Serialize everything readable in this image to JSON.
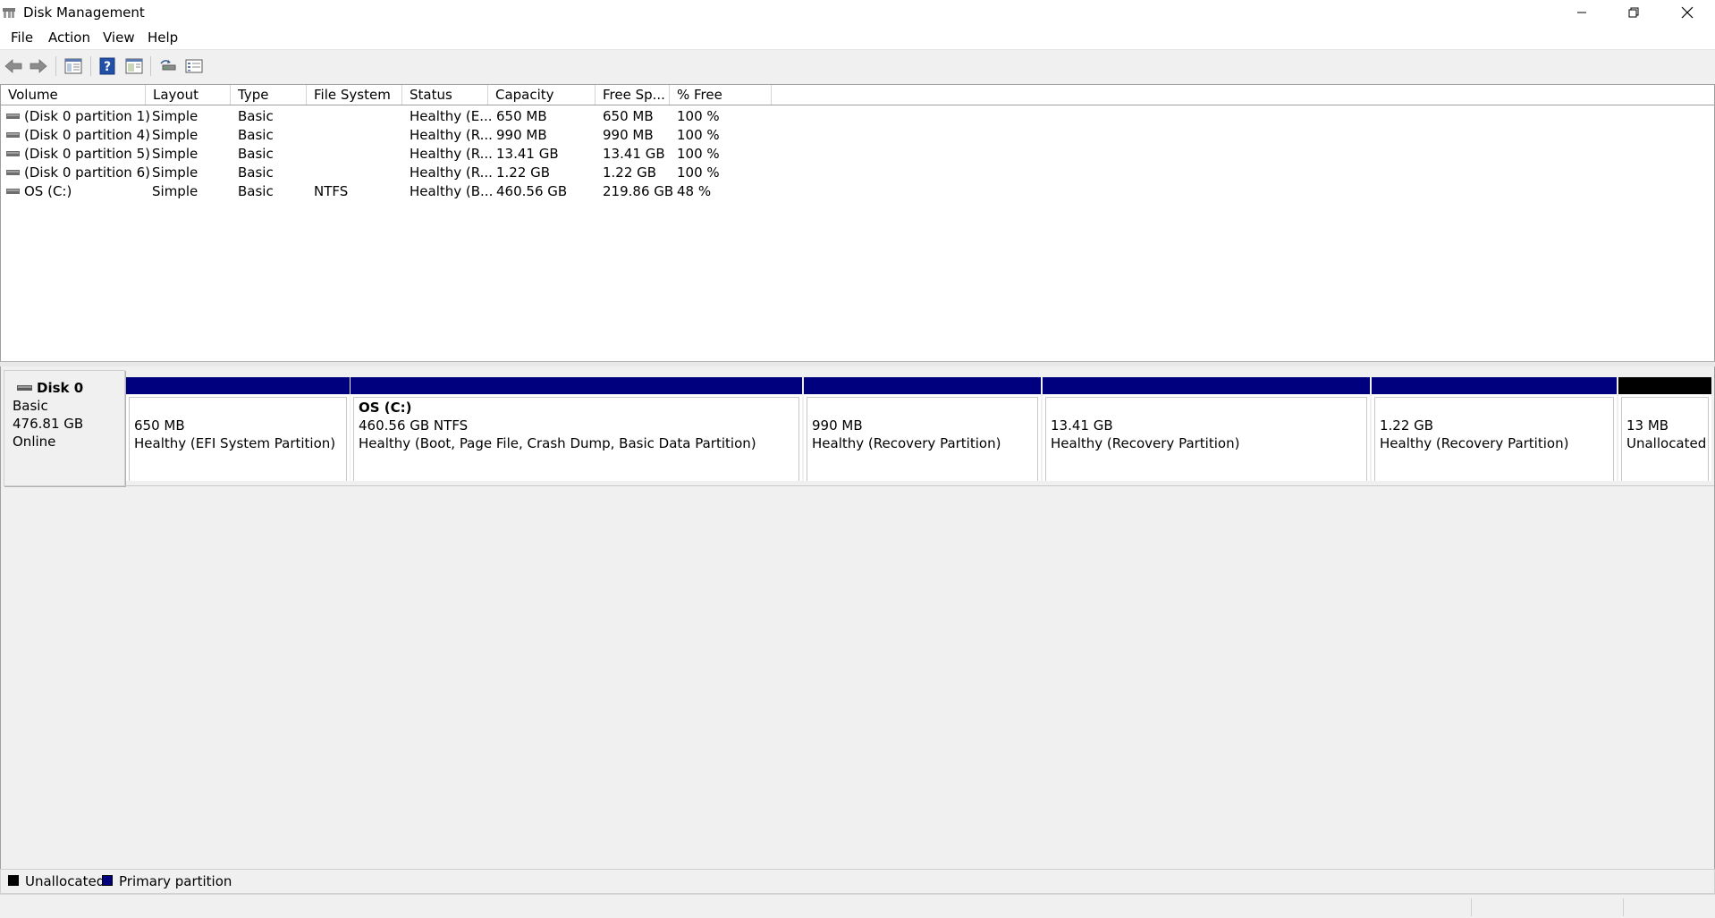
{
  "window": {
    "title": "Disk Management"
  },
  "menu": [
    "File",
    "Action",
    "View",
    "Help"
  ],
  "toolbar": {
    "icons": [
      "back-arrow-icon",
      "forward-arrow-icon",
      "show-hide-console-tree-icon",
      "help-icon",
      "properties-icon",
      "rescan-disks-icon",
      "list-view-icon"
    ]
  },
  "volumes": {
    "headers": [
      "Volume",
      "Layout",
      "Type",
      "File System",
      "Status",
      "Capacity",
      "Free Sp...",
      "% Free"
    ],
    "rows": [
      [
        "(Disk 0 partition 1)",
        "Simple",
        "Basic",
        "",
        "Healthy (E...",
        "650 MB",
        "650 MB",
        "100 %"
      ],
      [
        "(Disk 0 partition 4)",
        "Simple",
        "Basic",
        "",
        "Healthy (R...",
        "990 MB",
        "990 MB",
        "100 %"
      ],
      [
        "(Disk 0 partition 5)",
        "Simple",
        "Basic",
        "",
        "Healthy (R...",
        "13.41 GB",
        "13.41 GB",
        "100 %"
      ],
      [
        "(Disk 0 partition 6)",
        "Simple",
        "Basic",
        "",
        "Healthy (R...",
        "1.22 GB",
        "1.22 GB",
        "100 %"
      ],
      [
        "OS (C:)",
        "Simple",
        "Basic",
        "NTFS",
        "Healthy (B...",
        "460.56 GB",
        "219.86 GB",
        "48 %"
      ]
    ]
  },
  "disk": {
    "name": "Disk 0",
    "type": "Basic",
    "size": "476.81 GB",
    "state": "Online",
    "partitions": [
      {
        "name": "",
        "size": "650 MB",
        "status": "Healthy (EFI System Partition)",
        "kind": "primary"
      },
      {
        "name": "OS  (C:)",
        "size": "460.56 GB NTFS",
        "status": "Healthy (Boot, Page File, Crash Dump, Basic Data Partition)",
        "kind": "primary"
      },
      {
        "name": "",
        "size": "990 MB",
        "status": "Healthy (Recovery Partition)",
        "kind": "primary"
      },
      {
        "name": "",
        "size": "13.41 GB",
        "status": "Healthy (Recovery Partition)",
        "kind": "primary"
      },
      {
        "name": "",
        "size": "1.22 GB",
        "status": "Healthy (Recovery Partition)",
        "kind": "primary"
      },
      {
        "name": "",
        "size": "13 MB",
        "status": "Unallocated",
        "kind": "unallocated"
      }
    ]
  },
  "legend": {
    "unallocated": "Unallocated",
    "primary": "Primary partition"
  },
  "colors": {
    "primary": "#00007f",
    "unallocated": "#000000"
  }
}
